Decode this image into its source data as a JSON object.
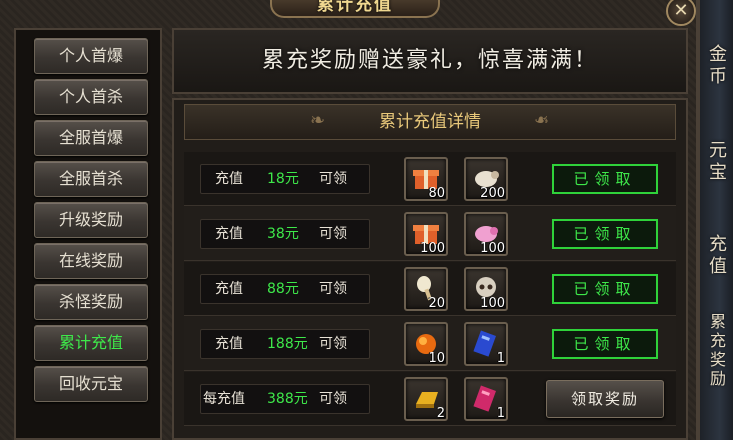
{
  "window": {
    "title": "累计充值",
    "close_label": "✕"
  },
  "sidebar": {
    "items": [
      {
        "label": "个人首爆",
        "active": false
      },
      {
        "label": "个人首杀",
        "active": false
      },
      {
        "label": "全服首爆",
        "active": false
      },
      {
        "label": "全服首杀",
        "active": false
      },
      {
        "label": "升级奖励",
        "active": false
      },
      {
        "label": "在线奖励",
        "active": false
      },
      {
        "label": "杀怪奖励",
        "active": false
      },
      {
        "label": "累计充值",
        "active": true
      },
      {
        "label": "回收元宝",
        "active": false
      }
    ]
  },
  "right_tabs": [
    {
      "label": "金币"
    },
    {
      "label": "元宝"
    },
    {
      "label": "充值"
    },
    {
      "label": "累充奖励"
    }
  ],
  "banner": {
    "text": "累充奖励赠送豪礼，惊喜满满！"
  },
  "panel": {
    "title": "累计充值详情",
    "rows": [
      {
        "prefix": "充值",
        "amount": "18元",
        "suffix": "可领",
        "items": [
          {
            "icon": "gift-box-icon",
            "qty": "80"
          },
          {
            "icon": "sheep-icon",
            "qty": "200"
          }
        ],
        "status": "已领取",
        "claimed": true
      },
      {
        "prefix": "充值",
        "amount": "38元",
        "suffix": "可领",
        "items": [
          {
            "icon": "gift-box-icon",
            "qty": "100"
          },
          {
            "icon": "pink-pig-icon",
            "qty": "100"
          }
        ],
        "status": "已领取",
        "claimed": true
      },
      {
        "prefix": "充值",
        "amount": "88元",
        "suffix": "可领",
        "items": [
          {
            "icon": "chicken-leg-icon",
            "qty": "20"
          },
          {
            "icon": "skull-icon",
            "qty": "100"
          }
        ],
        "status": "已领取",
        "claimed": true
      },
      {
        "prefix": "充值",
        "amount": "188元",
        "suffix": "可领",
        "items": [
          {
            "icon": "orange-orb-icon",
            "qty": "10"
          },
          {
            "icon": "blue-scroll-icon",
            "qty": "1"
          }
        ],
        "status": "已领取",
        "claimed": true
      },
      {
        "prefix": "每充值",
        "amount": "388元",
        "suffix": "可领",
        "items": [
          {
            "icon": "gold-bar-icon",
            "qty": "2"
          },
          {
            "icon": "red-scroll-icon",
            "qty": "1"
          }
        ],
        "status": "领取奖励",
        "claimed": false
      }
    ]
  },
  "colors": {
    "accent_green": "#3ee84a",
    "title_gold": "#e8c87a"
  }
}
